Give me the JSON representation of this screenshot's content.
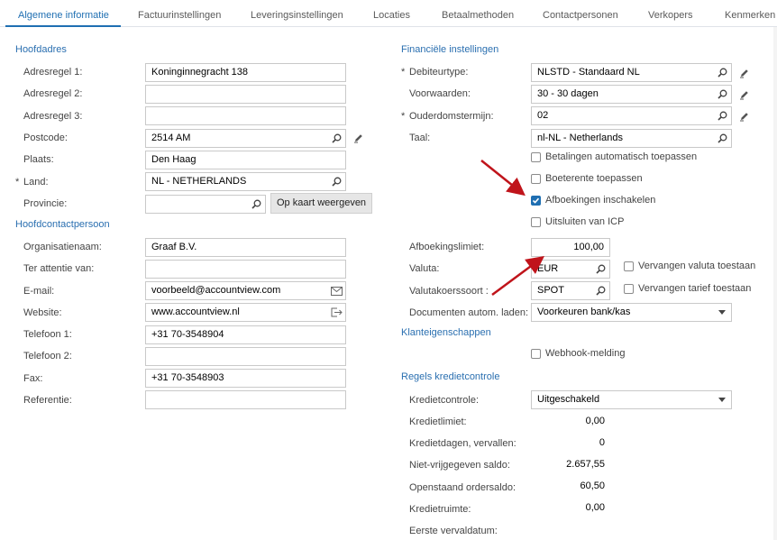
{
  "tabs": [
    "Algemene informatie",
    "Factuurinstellingen",
    "Leveringsinstellingen",
    "Locaties",
    "Betaalmethoden",
    "Contactpersonen",
    "Verkopers",
    "Kenmerken"
  ],
  "left": {
    "hoofdadres_title": "Hoofdadres",
    "adresregel1_label": "Adresregel 1:",
    "adresregel1_value": "Koninginnegracht 138",
    "adresregel2_label": "Adresregel 2:",
    "adresregel2_value": "",
    "adresregel3_label": "Adresregel 3:",
    "adresregel3_value": "",
    "postcode_label": "Postcode:",
    "postcode_value": "2514 AM",
    "plaats_label": "Plaats:",
    "plaats_value": "Den Haag",
    "land_label": "Land:",
    "land_value": "NL - NETHERLANDS",
    "provincie_label": "Provincie:",
    "provincie_value": "",
    "kaart_button": "Op kaart weergeven",
    "contact_title": "Hoofdcontactpersoon",
    "organisatie_label": "Organisatienaam:",
    "organisatie_value": "Graaf B.V.",
    "attentie_label": "Ter attentie van:",
    "attentie_value": "",
    "email_label": "E-mail:",
    "email_value": "voorbeeld@accountview.com",
    "website_label": "Website:",
    "website_value": "www.accountview.nl",
    "telefoon1_label": "Telefoon 1:",
    "telefoon1_value": "+31 70-3548904",
    "telefoon2_label": "Telefoon 2:",
    "telefoon2_value": "",
    "fax_label": "Fax:",
    "fax_value": "+31 70-3548903",
    "referentie_label": "Referentie:",
    "referentie_value": ""
  },
  "right": {
    "fin_title": "Financiële instellingen",
    "debiteurtype_label": "Debiteurtype:",
    "debiteurtype_value": "NLSTD - Standaard NL",
    "voorwaarden_label": "Voorwaarden:",
    "voorwaarden_value": "30 - 30 dagen",
    "ouderdom_label": "Ouderdomstermijn:",
    "ouderdom_value": "02",
    "taal_label": "Taal:",
    "taal_value": "nl-NL - Netherlands",
    "cb_betalingen": "Betalingen automatisch toepassen",
    "cb_boeterente": "Boeterente toepassen",
    "cb_afboekingen": "Afboekingen inschakelen",
    "cb_icp": "Uitsluiten van ICP",
    "afboekingslimiet_label": "Afboekingslimiet:",
    "afboekingslimiet_value": "100,00",
    "valuta_label": "Valuta:",
    "valuta_value": "EUR",
    "cb_vervangen_valuta": "Vervangen valuta toestaan",
    "koerssoort_label": "Valutakoerssoort :",
    "koerssoort_value": "SPOT",
    "cb_vervangen_tarief": "Vervangen tarief toestaan",
    "documenten_label": "Documenten autom. laden:",
    "documenten_value": "Voorkeuren bank/kas",
    "klant_title": "Klanteigenschappen",
    "cb_webhook": "Webhook-melding",
    "krediet_title": "Regels kredietcontrole",
    "kredietcontrole_label": "Kredietcontrole:",
    "kredietcontrole_value": "Uitgeschakeld",
    "kredietlimiet_label": "Kredietlimiet:",
    "kredietlimiet_value": "0,00",
    "kredietdagen_label": "Kredietdagen, vervallen:",
    "kredietdagen_value": "0",
    "nietvrij_label": "Niet-vrijgegeven saldo:",
    "nietvrij_value": "2.657,55",
    "openstaand_label": "Openstaand ordersaldo:",
    "openstaand_value": "60,50",
    "kredietruimte_label": "Kredietruimte:",
    "kredietruimte_value": "0,00",
    "eerste_label": "Eerste vervaldatum:",
    "eerste_value": ""
  },
  "checkbox_states": {
    "betalingen": false,
    "boeterente": false,
    "afboekingen": true,
    "icp": false,
    "vervangen_valuta": false,
    "vervangen_tarief": false,
    "webhook": false
  },
  "colors": {
    "accent": "#1f6fb2",
    "section": "#2a6fb0",
    "annotation_arrow": "#c0141b"
  }
}
